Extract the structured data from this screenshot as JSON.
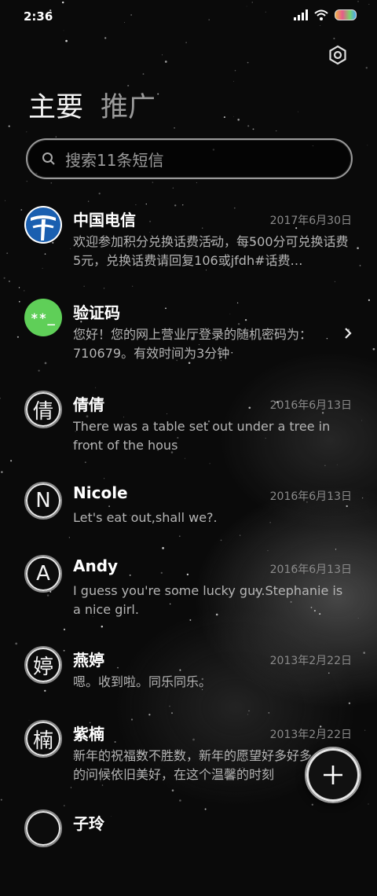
{
  "status_bar": {
    "time": "2:36"
  },
  "tabs": {
    "main": "主要",
    "promo": "推广"
  },
  "search": {
    "placeholder": "搜索11条短信"
  },
  "threads": [
    {
      "name": "中国电信",
      "date": "2017年6月30日",
      "preview": "欢迎参加积分兑换话费活动，每500分可兑换话费5元，兑换话费请回复106或jfdh#话费…",
      "avatar": "telecom-logo"
    },
    {
      "name": "验证码",
      "date": "",
      "preview": "您好！您的网上营业厅登录的随机密码为：710679。有效时间为3分钟",
      "avatar_text": "**_"
    },
    {
      "name": "倩倩",
      "date": "2016年6月13日",
      "preview": "There was a table set out under a tree in front of the hous",
      "avatar_text": "倩"
    },
    {
      "name": "Nicole",
      "date": "2016年6月13日",
      "preview": "Let's eat out,shall we?.",
      "avatar_text": "N"
    },
    {
      "name": "Andy",
      "date": "2016年6月13日",
      "preview": "I guess you're some lucky guy.Stephanie is a nice girl.",
      "avatar_text": "A"
    },
    {
      "name": "燕婷",
      "date": "2013年2月22日",
      "preview": "嗯。收到啦。同乐同乐。",
      "avatar_text": "婷"
    },
    {
      "name": "紫楠",
      "date": "2013年2月22日",
      "preview": "新年的祝福数不胜数，新年的愿望好多好多，新年的问候依旧美好，在这个温馨的时刻",
      "avatar_text": "楠"
    },
    {
      "name": "子玲",
      "date": "",
      "preview": "",
      "avatar_text": ""
    }
  ],
  "icons": {
    "settings": "gear-icon",
    "search": "search-icon",
    "fab": "plus-icon",
    "chevron": "chevron-right-icon"
  },
  "colors": {
    "background": "#0a0a0a",
    "code_avatar": "#5fcf58",
    "telecom_blue": "#1a5fb0"
  }
}
